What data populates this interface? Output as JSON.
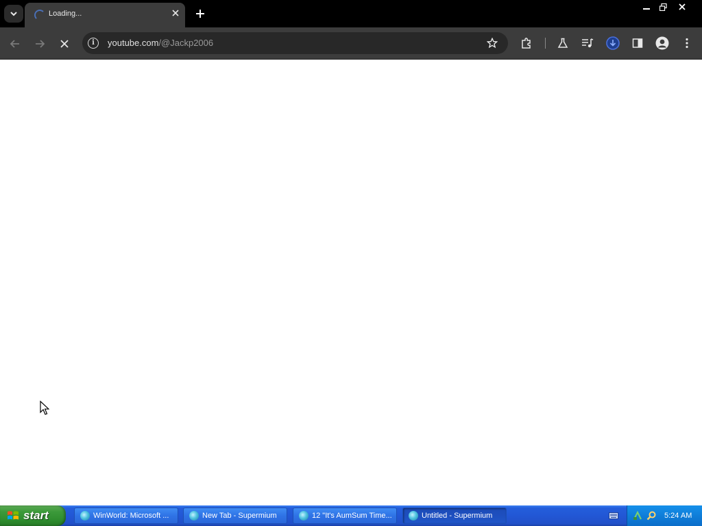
{
  "browser": {
    "tab": {
      "title": "Loading..."
    },
    "address_bar": {
      "url_host": "youtube.com",
      "url_path": "/@Jackp2006"
    }
  },
  "taskbar": {
    "start_label": "start",
    "tasks": [
      {
        "label": "WinWorld: Microsoft ..."
      },
      {
        "label": "New Tab - Supermium"
      },
      {
        "label": "12 \"It's AumSum Time..."
      },
      {
        "label": "Untitled - Supermium"
      }
    ],
    "clock": "5:24 AM"
  },
  "colors": {
    "tabstrip": "#000000",
    "toolbar": "#3c3c3c",
    "omnibox": "#282828",
    "taskbar_blue": "#245edb",
    "start_green": "#3c9a3a",
    "download_accent": "#4a6fd9"
  }
}
